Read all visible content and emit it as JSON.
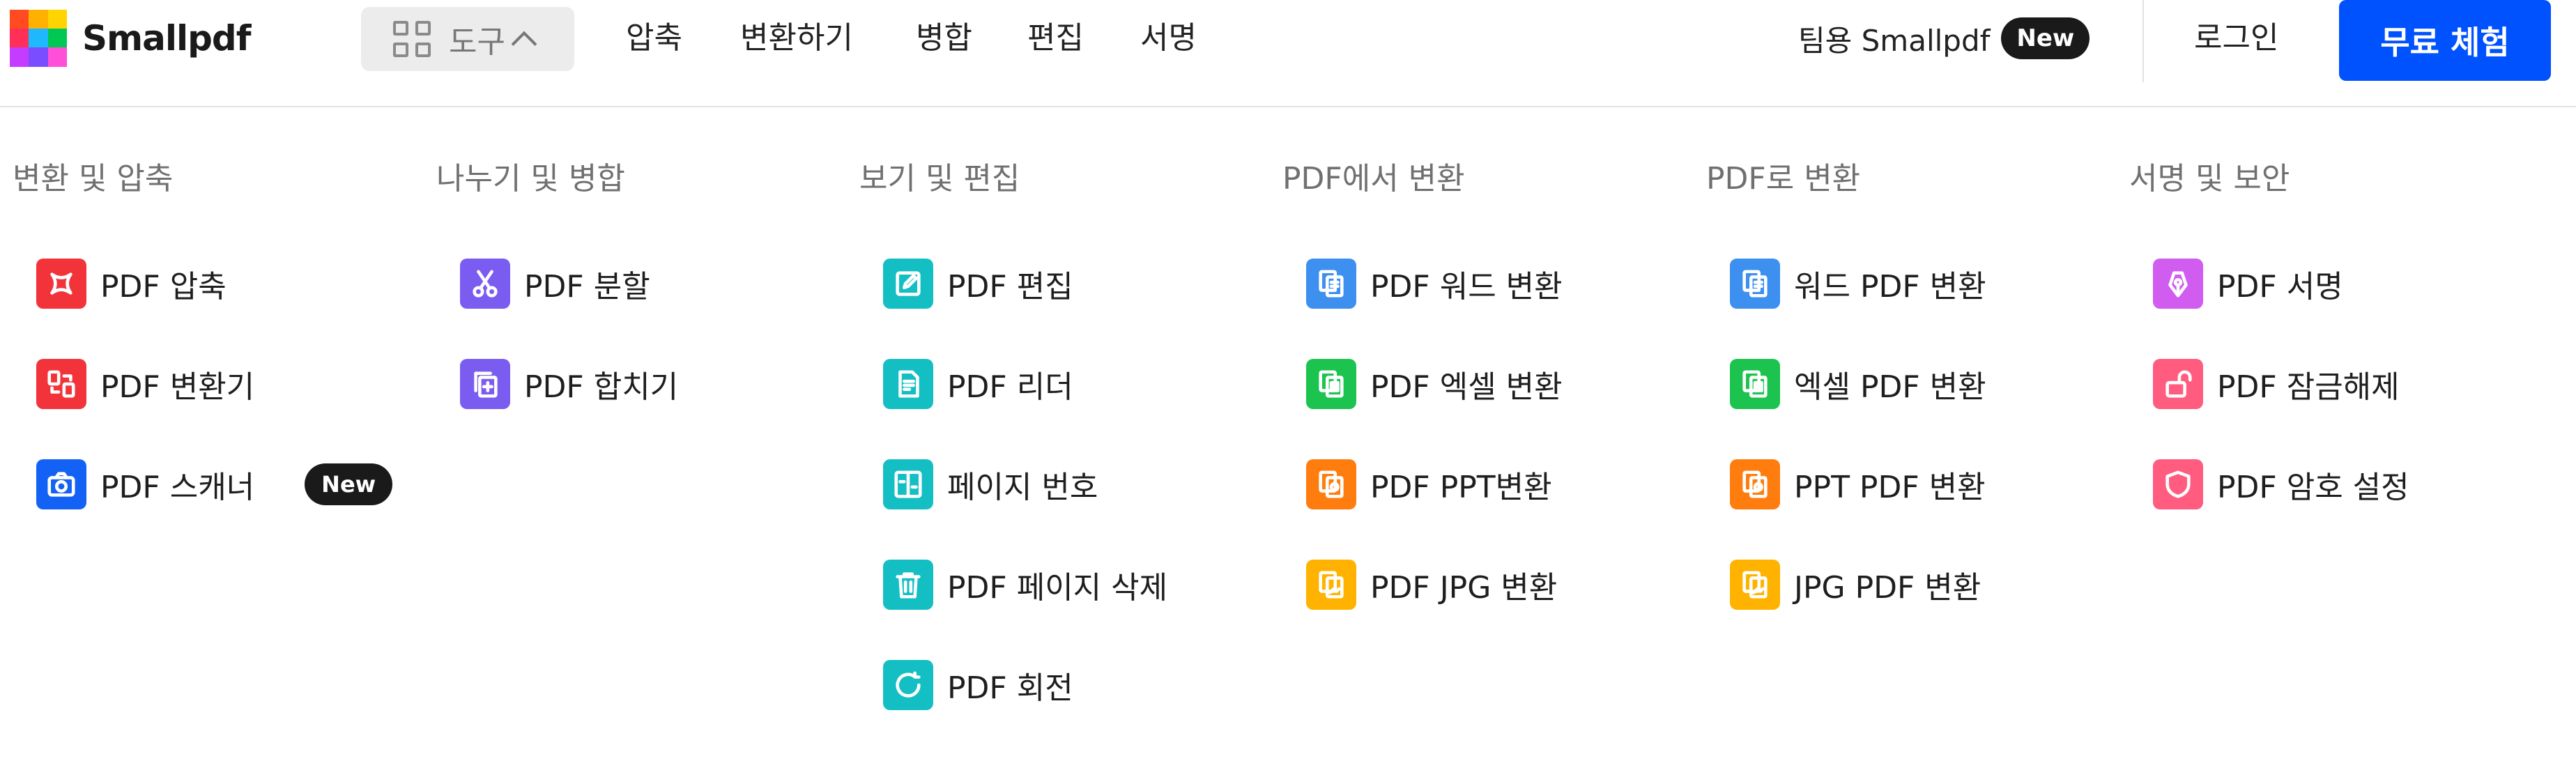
{
  "logo": {
    "name": "Smallpdf",
    "tiles": [
      "#ff4b1f",
      "#ffb000",
      "#ffd400",
      "#ff2f58",
      "#1fb8ff",
      "#00c853",
      "#c43cff",
      "#7a4dff",
      "#ff4fd8"
    ]
  },
  "header": {
    "tools_label": "도구",
    "nav": [
      "압축",
      "변환하기",
      "병합",
      "편집",
      "서명"
    ],
    "team_label": "팀용 Smallpdf",
    "team_badge": "New",
    "login_label": "로그인",
    "trial_label": "무료 체험"
  },
  "colors": {
    "accent": "#0052ff",
    "red": "#f2343a",
    "purple": "#7b5cf0",
    "teal": "#14bfc4",
    "blue": "#3d8ff0",
    "green": "#1dc34f",
    "orange": "#ff7d0f",
    "yellow": "#ffb300",
    "pink": "#ff5c80",
    "magenta": "#d05cf0",
    "camera_blue": "#1462f5"
  },
  "menu": {
    "columns": [
      {
        "heading": "변환 및 압축",
        "items": [
          {
            "label": "PDF 압축",
            "icon": "compress-icon",
            "color": "#f2343a"
          },
          {
            "label": "PDF 변환기",
            "icon": "convert-icon",
            "color": "#f2343a"
          },
          {
            "label": "PDF 스캐너",
            "icon": "camera-icon",
            "color": "#1462f5",
            "badge": "New"
          }
        ]
      },
      {
        "heading": "나누기 및 병합",
        "items": [
          {
            "label": "PDF 분할",
            "icon": "scissors-icon",
            "color": "#7b5cf0"
          },
          {
            "label": "PDF 합치기",
            "icon": "merge-icon",
            "color": "#7b5cf0"
          }
        ]
      },
      {
        "heading": "보기 및 편집",
        "items": [
          {
            "label": "PDF 편집",
            "icon": "edit-icon",
            "color": "#14bfc4"
          },
          {
            "label": "PDF 리더",
            "icon": "reader-icon",
            "color": "#14bfc4"
          },
          {
            "label": "페이지 번호",
            "icon": "page-number-icon",
            "color": "#14bfc4"
          },
          {
            "label": "PDF 페이지 삭제",
            "icon": "trash-icon",
            "color": "#14bfc4"
          },
          {
            "label": "PDF 회전",
            "icon": "rotate-icon",
            "color": "#14bfc4"
          }
        ]
      },
      {
        "heading": "PDF에서 변환",
        "items": [
          {
            "label": "PDF 워드 변환",
            "icon": "word-doc-icon",
            "color": "#3d8ff0"
          },
          {
            "label": "PDF 엑셀 변환",
            "icon": "excel-doc-icon",
            "color": "#1dc34f"
          },
          {
            "label": "PDF PPT변환",
            "icon": "ppt-doc-icon",
            "color": "#ff7d0f"
          },
          {
            "label": "PDF JPG 변환",
            "icon": "image-doc-icon",
            "color": "#ffb300"
          }
        ]
      },
      {
        "heading": "PDF로 변환",
        "items": [
          {
            "label": "워드 PDF 변환",
            "icon": "word-doc-icon",
            "color": "#3d8ff0"
          },
          {
            "label": "엑셀 PDF 변환",
            "icon": "excel-doc-icon",
            "color": "#1dc34f"
          },
          {
            "label": "PPT PDF 변환",
            "icon": "ppt-doc-icon",
            "color": "#ff7d0f"
          },
          {
            "label": "JPG PDF 변환",
            "icon": "image-doc-icon",
            "color": "#ffb300"
          }
        ]
      },
      {
        "heading": "서명 및 보안",
        "items": [
          {
            "label": "PDF 서명",
            "icon": "pen-nib-icon",
            "color": "#d05cf0"
          },
          {
            "label": "PDF 잠금해제",
            "icon": "unlock-icon",
            "color": "#ff5c80"
          },
          {
            "label": "PDF 암호 설정",
            "icon": "shield-icon",
            "color": "#ff5c80"
          }
        ]
      }
    ]
  }
}
